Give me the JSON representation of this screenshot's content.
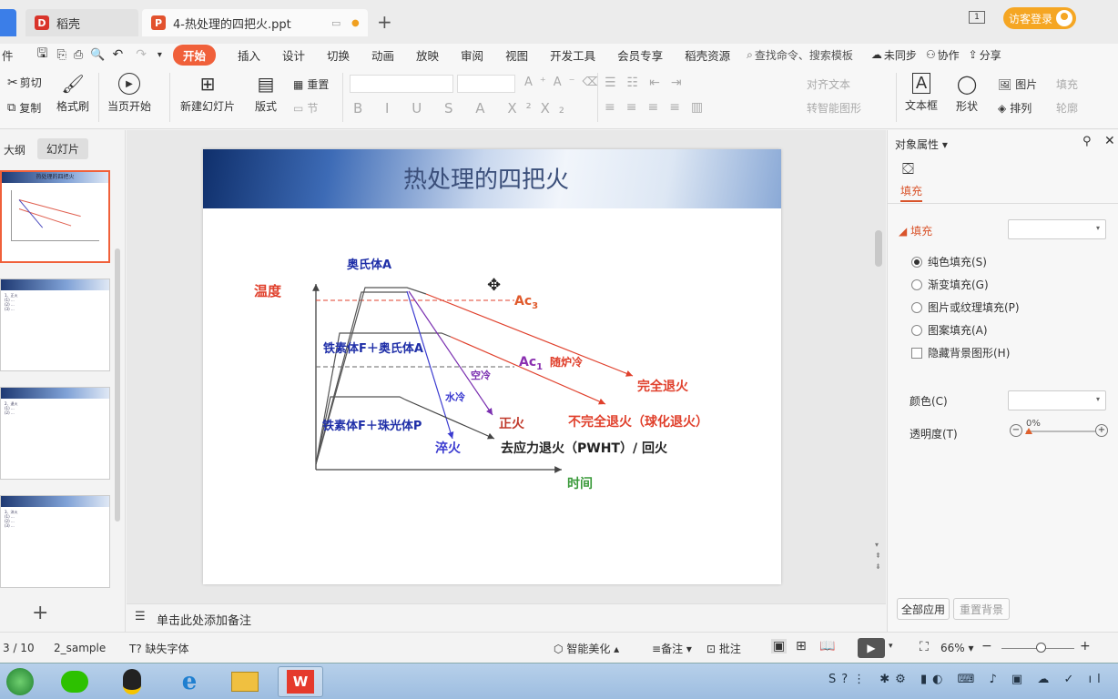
{
  "tabs": {
    "inactive": "稻壳",
    "active": "4-热处理的四把火.ppt",
    "new_tab": "+"
  },
  "account": {
    "login_label": "访客登录",
    "page_indicator": "1"
  },
  "menu": {
    "file": "件",
    "items": [
      "开始",
      "插入",
      "设计",
      "切换",
      "动画",
      "放映",
      "审阅",
      "视图",
      "开发工具",
      "会员专享",
      "稻壳资源"
    ],
    "search_placeholder": "查找命令、搜索模板",
    "sync": "未同步",
    "collab": "协作",
    "share": "分享"
  },
  "ribbon": {
    "cut": "剪切",
    "copy": "复制",
    "format_painter": "格式刷",
    "from_current": "当页开始",
    "new_slide": "新建幻灯片",
    "layout": "版式",
    "reset": "重置",
    "section": "节",
    "align_text": "对齐文本",
    "smartart": "转智能图形",
    "textbox": "文本框",
    "shape": "形状",
    "picture": "图片",
    "arrange": "排列",
    "fill": "填充",
    "outline": "轮廓"
  },
  "left_pane": {
    "outline_tab": "大纲",
    "slides_tab": "幻灯片",
    "add_slide": "+",
    "thumbs": [
      {
        "header": "热处理的四把火",
        "lines": []
      },
      {
        "header": "",
        "lines": [
          "1、正火",
          "(1) ...",
          "(2) ...",
          "(3) ..."
        ]
      },
      {
        "header": "",
        "lines": [
          "2、退火",
          "(1) ...",
          "(2) ..."
        ]
      },
      {
        "header": "",
        "lines": [
          "3、淬火",
          "(1) ...",
          "(2) ...",
          "(3) ..."
        ]
      }
    ]
  },
  "slide": {
    "title": "热处理的四把火",
    "labels": {
      "austenite": "奥氏体A",
      "temperature": "温度",
      "ac3": "Ac",
      "ac3_sub": "3",
      "ferrite_austenite": "铁素体F＋奥氏体A",
      "ac1": "Ac",
      "ac1_sub": "1",
      "furnace_cool": "随炉冷",
      "air_cool": "空冷",
      "water_cool": "水冷",
      "full_anneal": "完全退火",
      "normalize": "正火",
      "incomplete_anneal": "不完全退火（球化退火）",
      "ferrite_pearlite": "铁素体F＋珠光体P",
      "quench": "淬火",
      "stress_relief": "去应力退火（PWHT）/ 回火",
      "time": "时间"
    }
  },
  "notes": {
    "placeholder": "单击此处添加备注"
  },
  "right_pane": {
    "title": "对象属性",
    "fill_tab": "填充",
    "fill_section": "填充",
    "options": [
      "纯色填充(S)",
      "渐变填充(G)",
      "图片或纹理填充(P)",
      "图案填充(A)"
    ],
    "hide_bg": "隐藏背景图形(H)",
    "color_label": "颜色(C)",
    "transparency_label": "透明度(T)",
    "transparency_value": "0%",
    "apply_all": "全部应用",
    "reset_bg": "重置背景"
  },
  "status": {
    "page": "3 / 10",
    "template": "2_sample",
    "missing_font": "缺失字体",
    "beautify": "智能美化",
    "notes": "备注",
    "comment": "批注",
    "zoom": "66%"
  },
  "colors": {
    "accent": "#f0603a",
    "blue_label": "#1f2fa8",
    "red_label": "#e0402c",
    "orange_label": "#e05a2c",
    "green_label": "#3a9a3a"
  }
}
